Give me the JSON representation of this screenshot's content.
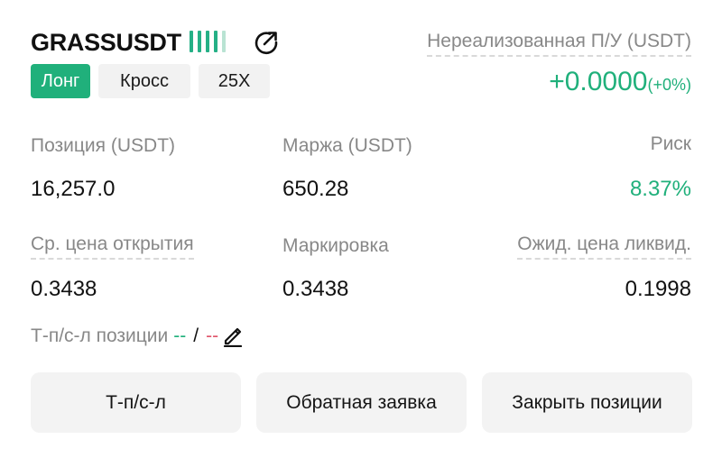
{
  "header": {
    "symbol": "GRASSUSDT",
    "signal_bars_filled": 4,
    "signal_bars_total": 5,
    "side": "Лонг",
    "margin_mode": "Кросс",
    "leverage": "25X"
  },
  "pnl": {
    "label": "Нереализованная П/У (USDT)",
    "value": "+0.0000",
    "percent": "(+0%)"
  },
  "stats": {
    "position_label": "Позиция (USDT)",
    "position_value": "16,257.0",
    "margin_label": "Маржа (USDT)",
    "margin_value": "650.28",
    "risk_label": "Риск",
    "risk_value": "8.37%",
    "avg_open_label": "Ср. цена открытия",
    "avg_open_value": "0.3438",
    "mark_label": "Маркировка",
    "mark_value": "0.3438",
    "liq_label": "Ожид. цена ликвид.",
    "liq_value": "0.1998"
  },
  "tpsl": {
    "label": "Т-п/с-л позиции",
    "tp_value": "--",
    "separator": "/",
    "sl_value": "--"
  },
  "actions": {
    "tpsl_button": "Т-п/с-л",
    "reverse_button": "Обратная заявка",
    "close_button": "Закрыть позиции"
  },
  "colors": {
    "accent_green": "#20b07b",
    "loss_red": "#e0556b"
  },
  "icons": {
    "share": "share-icon",
    "edit": "pencil-icon"
  }
}
